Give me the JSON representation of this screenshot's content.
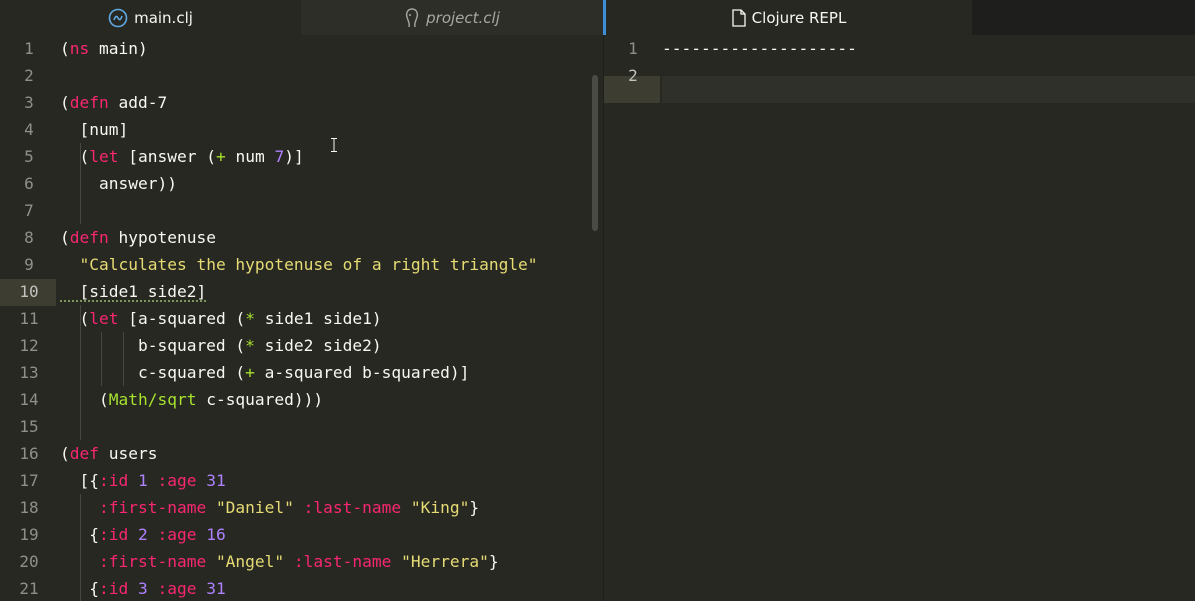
{
  "tabs": [
    {
      "label": "main.clj",
      "icon": "clojure-icon",
      "active": true
    },
    {
      "label": "project.clj",
      "icon": "leiningen-icon",
      "active": false
    },
    {
      "label": "Clojure REPL",
      "icon": "file-icon",
      "active": true
    }
  ],
  "editor": {
    "lines": [
      {
        "num": "1"
      },
      {
        "num": "2"
      },
      {
        "num": "3"
      },
      {
        "num": "4"
      },
      {
        "num": "5"
      },
      {
        "num": "6"
      },
      {
        "num": "7"
      },
      {
        "num": "8"
      },
      {
        "num": "9"
      },
      {
        "num": "10"
      },
      {
        "num": "11"
      },
      {
        "num": "12"
      },
      {
        "num": "13"
      },
      {
        "num": "14"
      },
      {
        "num": "15"
      },
      {
        "num": "16"
      },
      {
        "num": "17"
      },
      {
        "num": "18"
      },
      {
        "num": "19"
      },
      {
        "num": "20"
      },
      {
        "num": "21"
      }
    ],
    "current_line": "10",
    "code": {
      "l1a": "(",
      "l1b": "ns",
      "l1c": " main)",
      "l3a": "(",
      "l3b": "defn",
      "l3c": " add-7",
      "l4": "  [num]",
      "l5a": "  (",
      "l5b": "let",
      "l5c": " [answer (",
      "l5d": "+",
      "l5e": " num ",
      "l5f": "7",
      "l5g": ")]",
      "l6": "    answer))",
      "l8a": "(",
      "l8b": "defn",
      "l8c": " hypotenuse",
      "l9a": "  ",
      "l9b": "\"Calculates the hypotenuse of a right triangle\"",
      "l10": "  [side1 side2]",
      "l11a": "  (",
      "l11b": "let",
      "l11c": " [a-squared (",
      "l11d": "*",
      "l11e": " side1 side1)",
      "l12a": "        b-squared (",
      "l12b": "*",
      "l12c": " side2 side2)",
      "l13a": "        c-squared (",
      "l13b": "+",
      "l13c": " a-squared b-squared)]",
      "l14a": "    (",
      "l14b": "Math/sqrt",
      "l14c": " c-squared)))",
      "l16a": "(",
      "l16b": "def",
      "l16c": " users",
      "l17a": "  [{",
      "l17b": ":id",
      "l17c": " ",
      "l17d": "1",
      "l17e": " ",
      "l17f": ":age",
      "l17g": " ",
      "l17h": "31",
      "l18a": "    ",
      "l18b": ":first-name",
      "l18c": " ",
      "l18d": "\"Daniel\"",
      "l18e": " ",
      "l18f": ":last-name",
      "l18g": " ",
      "l18h": "\"King\"",
      "l18i": "}",
      "l19a": "   {",
      "l19b": ":id",
      "l19c": " ",
      "l19d": "2",
      "l19e": " ",
      "l19f": ":age",
      "l19g": " ",
      "l19h": "16",
      "l20a": "    ",
      "l20b": ":first-name",
      "l20c": " ",
      "l20d": "\"Angel\"",
      "l20e": " ",
      "l20f": ":last-name",
      "l20g": " ",
      "l20h": "\"Herrera\"",
      "l20i": "}",
      "l21a": "   {",
      "l21b": ":id",
      "l21c": " ",
      "l21d": "3",
      "l21e": " ",
      "l21f": ":age",
      "l21g": " ",
      "l21h": "31"
    }
  },
  "repl": {
    "lines": [
      {
        "num": "1"
      },
      {
        "num": "2"
      }
    ],
    "line1": "--------------------"
  },
  "colors": {
    "background": "#272822",
    "keyword": "#f92672",
    "string": "#e6db74",
    "number": "#ae81ff",
    "function": "#a6e22e",
    "accent": "#3d8fd6"
  }
}
